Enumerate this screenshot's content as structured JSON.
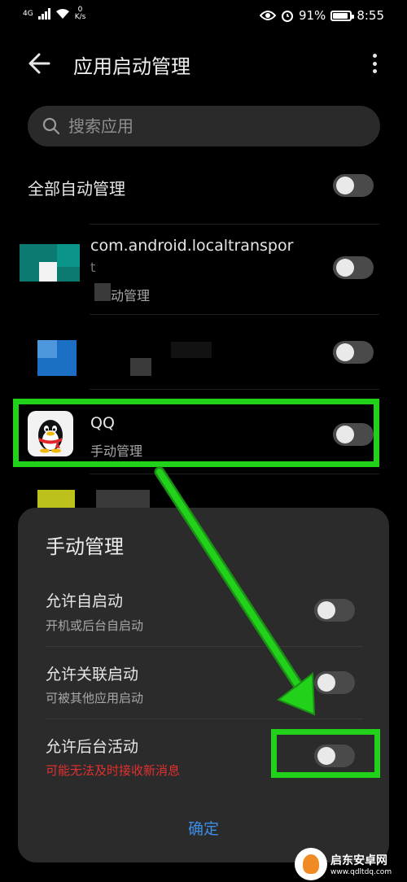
{
  "status_bar": {
    "network": "4G",
    "speed_value": "0",
    "speed_unit": "K/s",
    "battery": "91%",
    "battery_level": 0.91,
    "time": "8:55"
  },
  "header": {
    "title": "应用启动管理"
  },
  "search": {
    "placeholder": "搜索应用"
  },
  "all_auto": {
    "label": "全部自动管理",
    "on": false
  },
  "apps": [
    {
      "name": "com.android.localtranspor",
      "name_cont": "t",
      "status": "动管理",
      "on": false
    },
    {
      "name": "",
      "status": "",
      "on": false
    },
    {
      "name": "QQ",
      "status": "手动管理",
      "on": false
    }
  ],
  "sheet": {
    "title": "手动管理",
    "options": [
      {
        "title": "允许自启动",
        "subtitle": "开机或后台自启动",
        "on": false
      },
      {
        "title": "允许关联启动",
        "subtitle": "可被其他应用启动",
        "on": false
      },
      {
        "title": "允许后台活动",
        "subtitle": "可能无法及时接收新消息",
        "on": false
      }
    ],
    "confirm": "确定"
  },
  "colors": {
    "background": "#000000",
    "sheet": "#2b2b2b",
    "accent": "#3d8ee6",
    "warning": "#e23030",
    "annotation": "#22d11a"
  },
  "watermark": {
    "name": "启东安卓网",
    "url": "www.qdltdq.com"
  }
}
